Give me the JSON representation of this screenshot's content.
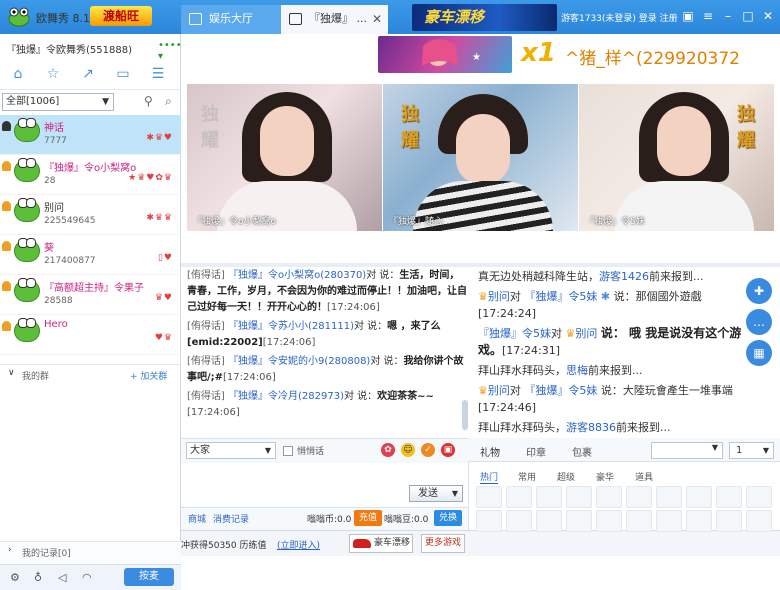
{
  "app": {
    "title": "欧舞秀 8.1",
    "badge": "渡船旺",
    "user_status": "游客1733(未登录) 登录 注册"
  },
  "tabs": [
    {
      "label": "娱乐大厅"
    },
    {
      "label": "『独爆』 ..."
    }
  ],
  "banner": {
    "top_ad": "豪车漂移"
  },
  "left": {
    "room_name": "『独爆』令欧舞秀(551888)",
    "filter": "全部[1006]",
    "users": [
      {
        "name": "神话",
        "id": "7777",
        "badges": "✱♛♥"
      },
      {
        "name": "『独爆』令o小梨窝o",
        "id": "28",
        "badges": "★♛♥✿♛"
      },
      {
        "name": "别问",
        "id": "225549645",
        "badges": "✱♛♛"
      },
      {
        "name": "葵",
        "id": "217400877",
        "badges": "▯♥"
      },
      {
        "name": "『高额超主持』令果子",
        "id": "28588",
        "badges": "♛♥"
      },
      {
        "name": "Hero",
        "id": "",
        "badges": "♥♛"
      }
    ],
    "group_label": "我的群",
    "add_group": "+ 加关群",
    "history_label": "我的记录[0]",
    "talk_button": "按麦"
  },
  "gift_banner": {
    "count": "x1",
    "text": "^猪_样^(229920372"
  },
  "videos": [
    {
      "label": "『独爆』令o小梨窝o",
      "stamp": "独\n耀"
    },
    {
      "label": "『独爆』随心",
      "stamp": "独\n耀"
    },
    {
      "label": "『独爆』令5妹",
      "stamp": "独\n耀"
    }
  ],
  "chat_public": [
    {
      "tag": "[侑得话]",
      "name": "『独爆』令o小梨窝o(280370)",
      "verb": "对",
      "target": "说：",
      "text": "生活，时间，青春，工作，岁月，不会因为你的难过而停止！！加油吧，让自己过好每一天！！开开心心的！",
      "time": "[17:24:06]"
    },
    {
      "tag": "[侑得话]",
      "name": "『独爆』令苏小小(281111)",
      "verb": "对",
      "target": "说：",
      "text": "嗯 ，来了么[emid:22002]",
      "time": "[17:24:06]"
    },
    {
      "tag": "[侑得话]",
      "name": "『独爆』令安妮的小9(280808)",
      "verb": "对",
      "target": "说：",
      "text": "我给你讲个故事吧/;#",
      "time": "[17:24:06]"
    },
    {
      "tag": "[侑得话]",
      "name": "『独爆』令冷月(282973)",
      "verb": "对",
      "target": "说：",
      "text": "欢迎茶茶~~",
      "time": "[17:24:06]"
    }
  ],
  "chat_private": [
    {
      "kind": "sys",
      "pre": "真无边处稍越科降生站，",
      "hl": "游客1426",
      "post": "前来报到..."
    },
    {
      "kind": "msg",
      "name": "别问",
      "mid": "对",
      "name2": "『独爆』令5妹",
      "text": "说：那個國外遊戲",
      "time": "[17:24:24]"
    },
    {
      "kind": "big",
      "name": "『独爆』令5妹",
      "mid": "对",
      "name2": "别问",
      "text": "说：  哦  我是说没有这个游戏。",
      "time": "[17:24:31]"
    },
    {
      "kind": "sys",
      "pre": "拜山拜水拜码头，",
      "hl": "思梅",
      "post": "前来报到..."
    },
    {
      "kind": "msg",
      "name": "别问",
      "mid": "对",
      "name2": "『独爆』令5妹",
      "text": "说：大陸玩會產生一堆事端",
      "time": "[17:24:46]"
    },
    {
      "kind": "sys",
      "pre": "拜山拜水拜码头，",
      "hl": "游客8836",
      "post": "前来报到..."
    }
  ],
  "input": {
    "target": "大家",
    "private_label": "悄悄话",
    "send": "发送"
  },
  "bottom": {
    "mall": "商城",
    "records": "消费记录",
    "coins": "嗡嗡币:0.0",
    "recharge": "充值",
    "beans": "嗡嗡豆:0.0",
    "exchange": "兑换"
  },
  "promo": {
    "text": "冲获得50350 历练值",
    "link": "(立即进入)",
    "race": "豪车漂移",
    "more": "更多游戏"
  },
  "gift_panel": {
    "tabs": [
      "礼物",
      "印章",
      "包裹"
    ],
    "qty": "1",
    "categories": [
      "热门",
      "常用",
      "超级",
      "豪华",
      "道具"
    ]
  },
  "colors": {
    "accent": "#2b86d9",
    "selected_row": "#bfe4fa",
    "orange": "#f07a10"
  }
}
